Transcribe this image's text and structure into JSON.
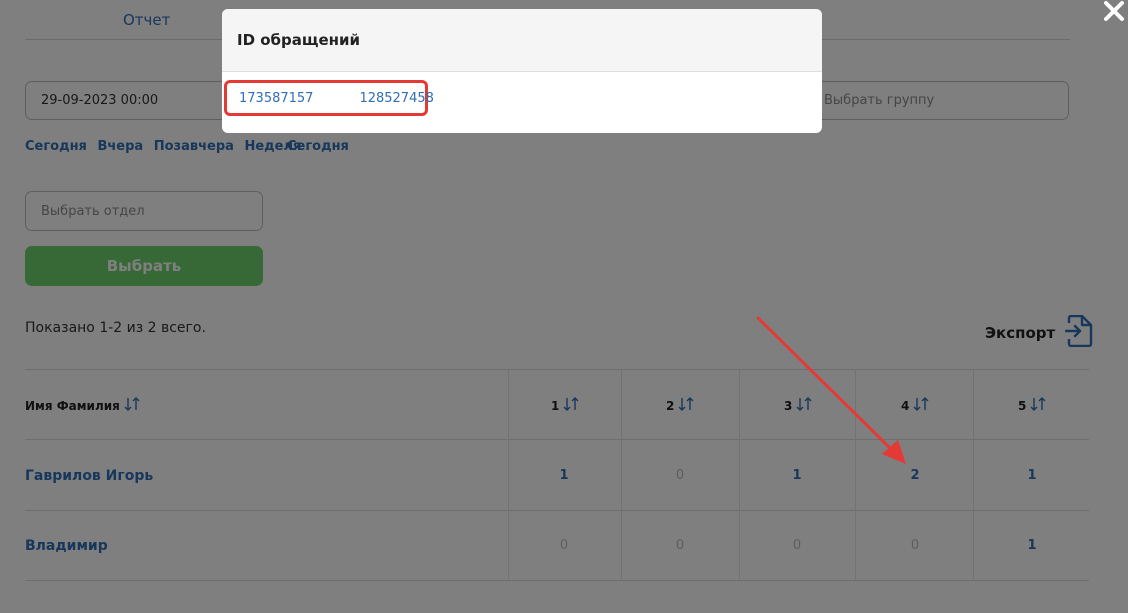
{
  "header": {
    "tab_report": "Отчет"
  },
  "filters": {
    "date_from_value": "29-09-2023 00:00",
    "group_placeholder": "Выбрать группу",
    "department_placeholder": "Выбрать отдел",
    "quick_left": [
      "Сегодня",
      "Вчера",
      "Позавчера",
      "Неделя"
    ],
    "quick_right": [
      "Сегодня"
    ],
    "select_button": "Выбрать"
  },
  "summary": "Показано 1-2 из 2 всего.",
  "export": {
    "label": "Экспорт",
    "icon": "export-file-icon"
  },
  "table": {
    "columns": [
      "Имя Фамилия",
      "1",
      "2",
      "3",
      "4",
      "5"
    ],
    "rows": [
      {
        "name": "Гаврилов Игорь",
        "values": [
          "1",
          "0",
          "1",
          "2",
          "1"
        ]
      },
      {
        "name": "Владимир",
        "values": [
          "0",
          "0",
          "0",
          "0",
          "1"
        ]
      }
    ]
  },
  "modal": {
    "title": "ID обращений",
    "ids": [
      "173587157",
      "128527458"
    ]
  },
  "colors": {
    "accent": "#2f6fb6",
    "button_green": "#6dd26c",
    "highlight_red": "#e53935",
    "overlay": "rgba(0,0,0,0.5)"
  }
}
